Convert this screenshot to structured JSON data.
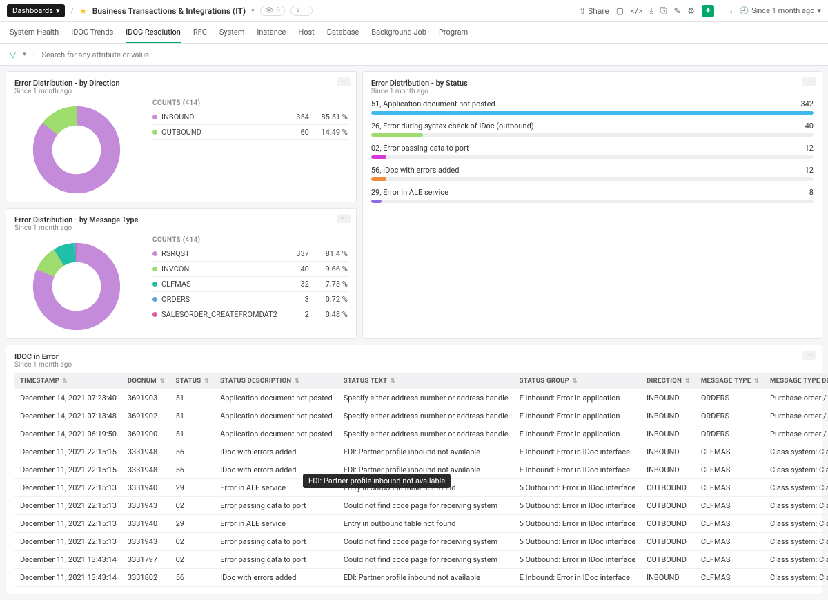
{
  "header": {
    "dashboards_label": "Dashboards",
    "title": "Business Transactions & Integrations (IT)",
    "views": "8",
    "shares": "1",
    "share_label": "Share",
    "time_range": "Since 1 month ago"
  },
  "tabs": [
    "System Health",
    "IDOC Trends",
    "IDOC Resolution",
    "RFC",
    "System",
    "Instance",
    "Host",
    "Database",
    "Background Job",
    "Program"
  ],
  "active_tab": 2,
  "search": {
    "placeholder": "Search for any attribute or value..."
  },
  "card_direction": {
    "title": "Error Distribution - by Direction",
    "sub": "Since 1 month ago",
    "counts_label": "COUNTS (414)",
    "chart_data": {
      "type": "pie",
      "series": [
        {
          "name": "INBOUND",
          "value": 354,
          "pct": "85.51 %",
          "color": "#c58bdb"
        },
        {
          "name": "OUTBOUND",
          "value": 60,
          "pct": "14.49 %",
          "color": "#9fdc6e"
        }
      ]
    }
  },
  "card_msgtype": {
    "title": "Error Distribution - by Message Type",
    "sub": "Since 1 month ago",
    "counts_label": "COUNTS (414)",
    "chart_data": {
      "type": "pie",
      "series": [
        {
          "name": "RSRQST",
          "value": 337,
          "pct": "81.4 %",
          "color": "#c58bdb"
        },
        {
          "name": "INVCON",
          "value": 40,
          "pct": "9.66 %",
          "color": "#9fdc6e"
        },
        {
          "name": "CLFMAS",
          "value": 32,
          "pct": "7.73 %",
          "color": "#1fbfa8"
        },
        {
          "name": "ORDERS",
          "value": 3,
          "pct": "0.72 %",
          "color": "#5aa5e0"
        },
        {
          "name": "SALESORDER_CREATEFROMDAT2",
          "value": 2,
          "pct": "0.48 %",
          "color": "#e05aa5"
        }
      ]
    }
  },
  "card_status": {
    "title": "Error Distribution - by Status",
    "sub": "Since 1 month ago",
    "chart_data": {
      "type": "bar",
      "max": 342,
      "items": [
        {
          "label": "51, Application document not posted",
          "value": 342,
          "color": "#3fb8f0"
        },
        {
          "label": "26, Error during syntax check of IDoc (outbound)",
          "value": 40,
          "color": "#9fdc6e"
        },
        {
          "label": "02, Error passing data to port",
          "value": 12,
          "color": "#d63ad6"
        },
        {
          "label": "56, IDoc with errors added",
          "value": 12,
          "color": "#f08b3f"
        },
        {
          "label": "29, Error in ALE service",
          "value": 8,
          "color": "#8a6de0"
        }
      ]
    }
  },
  "card_table": {
    "title": "IDOC in Error",
    "sub": "Since 1 month ago",
    "columns": [
      "TIMESTAMP",
      "DOCNUM",
      "STATUS",
      "STATUS DESCRIPTION",
      "STATUS TEXT",
      "STATUS GROUP",
      "DIRECTION",
      "MESSAGE TYPE",
      "MESSAGE TYPE DESCRIPTION"
    ],
    "rows": [
      [
        "December 14, 2021 07:23:40",
        "3691903",
        "51",
        "Application document not posted",
        "Specify either address number or address handle",
        "F Inbound: Error in application",
        "INBOUND",
        "ORDERS",
        "Purchase order / order"
      ],
      [
        "December 14, 2021 07:13:48",
        "3691902",
        "51",
        "Application document not posted",
        "Specify either address number or address handle",
        "F Inbound: Error in application",
        "INBOUND",
        "ORDERS",
        "Purchase order / order"
      ],
      [
        "December 14, 2021 06:19:50",
        "3691900",
        "51",
        "Application document not posted",
        "Specify either address number or address handle",
        "F Inbound: Error in application",
        "INBOUND",
        "ORDERS",
        "Purchase order / order"
      ],
      [
        "December 11, 2021 22:15:15",
        "3331948",
        "56",
        "IDoc with errors added",
        "EDI: Partner profile inbound not available",
        "E Inbound: Error in IDoc interface",
        "INBOUND",
        "CLFMAS",
        "Class system: Classification mast"
      ],
      [
        "December 11, 2021 22:15:15",
        "3331948",
        "56",
        "IDoc with errors added",
        "EDI: Partner profile inbound not available",
        "E Inbound: Error in IDoc interface",
        "INBOUND",
        "CLFMAS",
        "Class system: Classification mast"
      ],
      [
        "December 11, 2021 22:15:13",
        "3331940",
        "29",
        "Error in ALE service",
        "Entry in outbound table not found",
        "5 Outbound: Error in IDoc interface",
        "OUTBOUND",
        "CLFMAS",
        "Class system: Classification mast"
      ],
      [
        "December 11, 2021 22:15:13",
        "3331943",
        "02",
        "Error passing data to port",
        "Could not find code page for receiving system",
        "5 Outbound: Error in IDoc interface",
        "OUTBOUND",
        "CLFMAS",
        "Class system: Classification mast"
      ],
      [
        "December 11, 2021 22:15:13",
        "3331940",
        "29",
        "Error in ALE service",
        "Entry in outbound table not found",
        "5 Outbound: Error in IDoc interface",
        "OUTBOUND",
        "CLFMAS",
        "Class system: Classification mast"
      ],
      [
        "December 11, 2021 22:15:13",
        "3331943",
        "02",
        "Error passing data to port",
        "Could not find code page for receiving system",
        "5 Outbound: Error in IDoc interface",
        "OUTBOUND",
        "CLFMAS",
        "Class system: Classification mast"
      ],
      [
        "December 11, 2021 13:43:14",
        "3331797",
        "02",
        "Error passing data to port",
        "Could not find code page for receiving system",
        "5 Outbound: Error in IDoc interface",
        "OUTBOUND",
        "CLFMAS",
        "Class system: Classification mast"
      ],
      [
        "December 11, 2021 13:43:14",
        "3331802",
        "56",
        "IDoc with errors added",
        "EDI: Partner profile inbound not available",
        "E Inbound: Error in IDoc interface",
        "INBOUND",
        "CLFMAS",
        "Class system: Classification mast"
      ]
    ]
  },
  "tooltip": {
    "text": "EDI: Partner profile inbound not available"
  }
}
